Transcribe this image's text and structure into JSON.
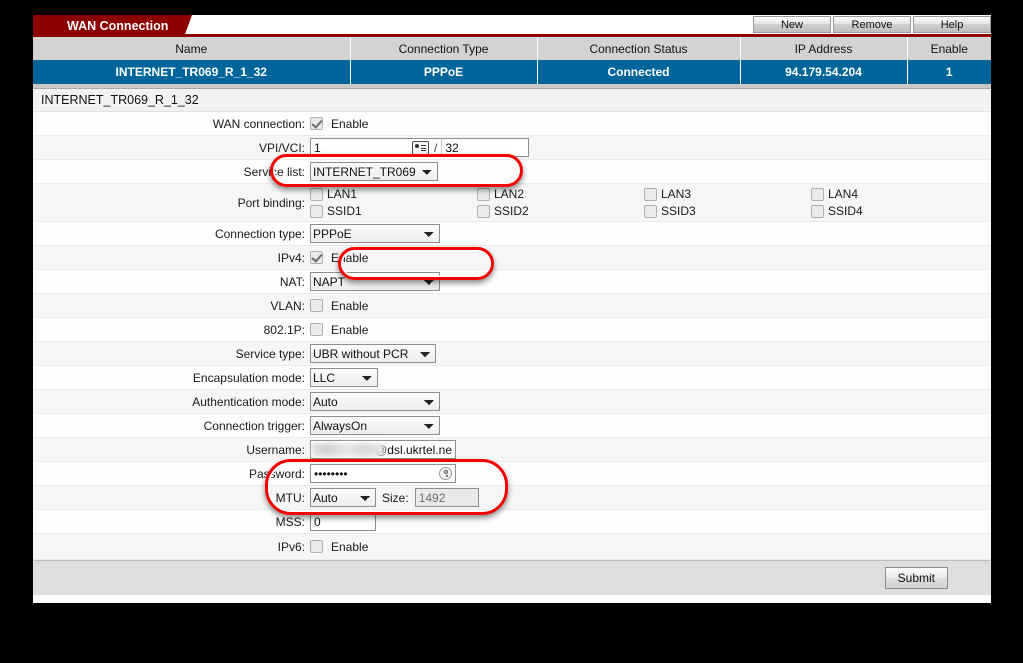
{
  "window": {
    "tab_label": "WAN Connection",
    "toolbar": [
      {
        "label": "New",
        "name": "new-button"
      },
      {
        "label": "Remove",
        "name": "remove-button"
      },
      {
        "label": "Help",
        "name": "help-button"
      }
    ]
  },
  "connection_table": {
    "headers": [
      "Name",
      "Connection Type",
      "Connection Status",
      "IP Address",
      "Enable"
    ],
    "rows": [
      {
        "name": "INTERNET_TR069_R_1_32",
        "type": "PPPoE",
        "status": "Connected",
        "ip": "94.179.54.204",
        "enable": "1"
      }
    ]
  },
  "detail": {
    "title": "INTERNET_TR069_R_1_32",
    "wan_connection": {
      "label": "WAN connection:",
      "checkbox_label": "Enable",
      "checked": true
    },
    "vpi_vci": {
      "label": "VPI/VCI:",
      "vpi": "1",
      "vci": "32",
      "separator": "/"
    },
    "service_list": {
      "label": "Service list:",
      "value": "INTERNET_TR069"
    },
    "port_binding": {
      "label": "Port binding:",
      "items": [
        {
          "label": "LAN1",
          "checked": false
        },
        {
          "label": "LAN2",
          "checked": false
        },
        {
          "label": "LAN3",
          "checked": false
        },
        {
          "label": "LAN4",
          "checked": false
        },
        {
          "label": "SSID1",
          "checked": false
        },
        {
          "label": "SSID2",
          "checked": false
        },
        {
          "label": "SSID3",
          "checked": false
        },
        {
          "label": "SSID4",
          "checked": false
        }
      ]
    },
    "connection_type": {
      "label": "Connection type:",
      "value": "PPPoE"
    },
    "ipv4": {
      "label": "IPv4:",
      "checkbox_label": "Enable",
      "checked": true
    },
    "nat": {
      "label": "NAT:",
      "value": "NAPT"
    },
    "vlan": {
      "label": "VLAN:",
      "checkbox_label": "Enable",
      "checked": false
    },
    "dot1p": {
      "label": "802.1P:",
      "checkbox_label": "Enable",
      "checked": false
    },
    "service_type": {
      "label": "Service type:",
      "value": "UBR without PCR"
    },
    "encapsulation_mode": {
      "label": "Encapsulation mode:",
      "value": "LLC"
    },
    "authentication_mode": {
      "label": "Authentication mode:",
      "value": "Auto"
    },
    "connection_trigger": {
      "label": "Connection trigger:",
      "value": "AlwaysOn"
    },
    "username": {
      "label": "Username:",
      "value": "@dsl.ukrtel.ne"
    },
    "password": {
      "label": "Password:",
      "value": "••••••••"
    },
    "mtu": {
      "label": "MTU:",
      "value": "Auto",
      "size_label": "Size:",
      "size_value": "1492"
    },
    "mss": {
      "label": "MSS:",
      "value": "0"
    },
    "ipv6": {
      "label": "IPv6:",
      "checkbox_label": "Enable",
      "checked": false
    },
    "submit_label": "Submit"
  },
  "colors": {
    "tab_red": "#8c0000",
    "row_blue": "#00659b",
    "header_gray": "#d3d3d3",
    "annotation_red": "#f40000"
  }
}
